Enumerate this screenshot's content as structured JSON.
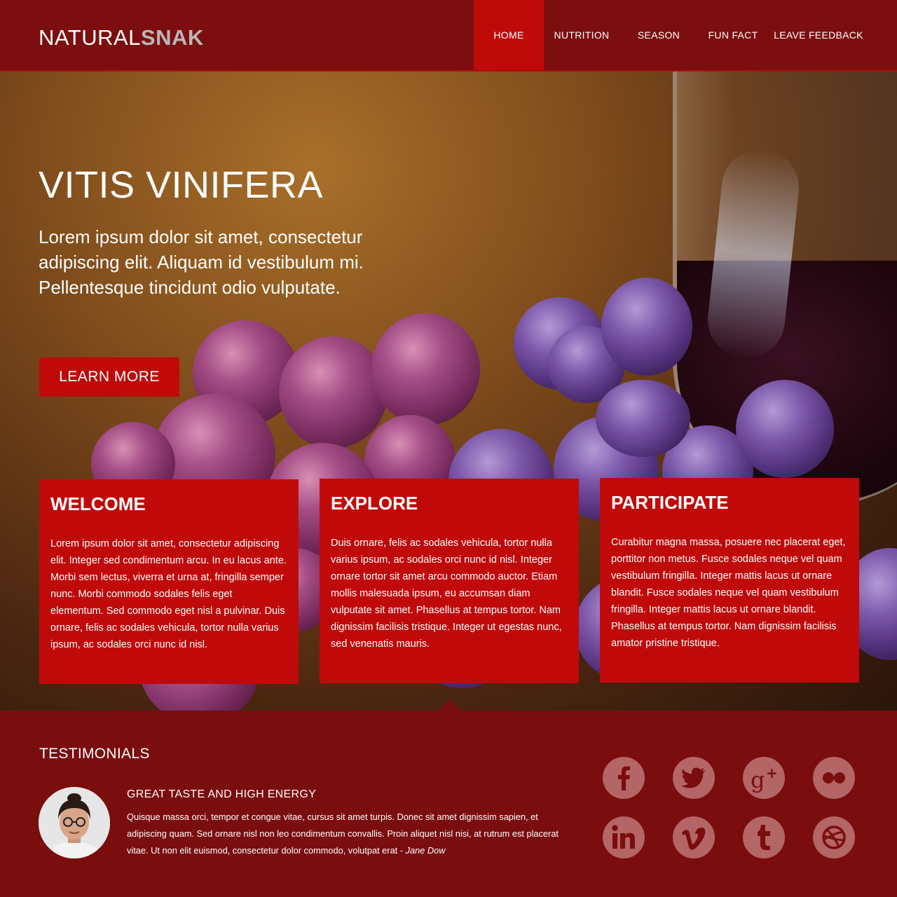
{
  "brand": {
    "part1": "NATURAL",
    "part2": "SNAK"
  },
  "nav": {
    "items": [
      {
        "label": "HOME",
        "active": true
      },
      {
        "label": "NUTRITION"
      },
      {
        "label": "SEASON"
      },
      {
        "label": "FUN FACT"
      },
      {
        "label": "LEAVE FEEDBACK"
      }
    ]
  },
  "hero": {
    "title": "VITIS VINIFERA",
    "text": "Lorem ipsum dolor sit amet, consectetur adipiscing elit. Aliquam id vestibulum mi. Pellentesque tincidunt odio vulputate.",
    "button": "LEARN MORE"
  },
  "cards": [
    {
      "title": "WELCOME",
      "text": "Lorem ipsum dolor sit amet, consectetur adipiscing elit. Integer sed condimentum arcu. In eu lacus ante. Morbi sem lectus, viverra et urna at, fringilla semper nunc. Morbi commodo sodales felis eget elementum. Sed commodo eget nisl a pulvinar. Duis ornare, felis ac sodales vehicula, tortor nulla varius ipsum, ac sodales orci nunc id nisl."
    },
    {
      "title": "EXPLORE",
      "text": "Duis ornare, felis ac sodales vehicula, tortor nulla varius ipsum, ac sodales orci nunc id nisl. Integer ornare tortor sit amet arcu commodo auctor. Etiam mollis malesuada ipsum, eu accumsan diam vulputate sit amet. Phasellus at tempus tortor. Nam dignissim facilisis tristique. Integer ut egestas nunc, sed venenatis mauris."
    },
    {
      "title": "PARTICIPATE",
      "text": "Curabitur magna massa, posuere nec placerat eget, porttitor non metus. Fusce sodales neque vel quam vestibulum fringilla. Integer mattis lacus ut ornare blandit. Fusce sodales neque vel quam vestibulum fringilla. Integer mattis lacus ut ornare blandit. Phasellus at tempus tortor. Nam dignissim facilisis amator pristine tristique."
    }
  ],
  "testimonials": {
    "title": "TESTIMONIALS",
    "heading": "GREAT TASTE AND HIGH ENERGY",
    "text": "Quisque massa orci, tempor et congue vitae, cursus sit amet turpis. Donec sit amet dignissim sapien, et adipiscing quam. Sed ornare nisl non leo condimentum convallis. Proin aliquet nisl nisi, at rutrum est placerat vitae. Ut non elit euismod, consectetur dolor commodo, volutpat erat - ",
    "author": "Jane Dow"
  },
  "social": [
    "facebook-icon",
    "twitter-icon",
    "google-plus-icon",
    "flickr-icon",
    "linkedin-icon",
    "vimeo-icon",
    "tumblr-icon",
    "dribbble-icon"
  ],
  "colors": {
    "header": "#7c0e0f",
    "accent": "#c00a0a",
    "footer": "#7a0d0e",
    "social": "#b46565"
  }
}
